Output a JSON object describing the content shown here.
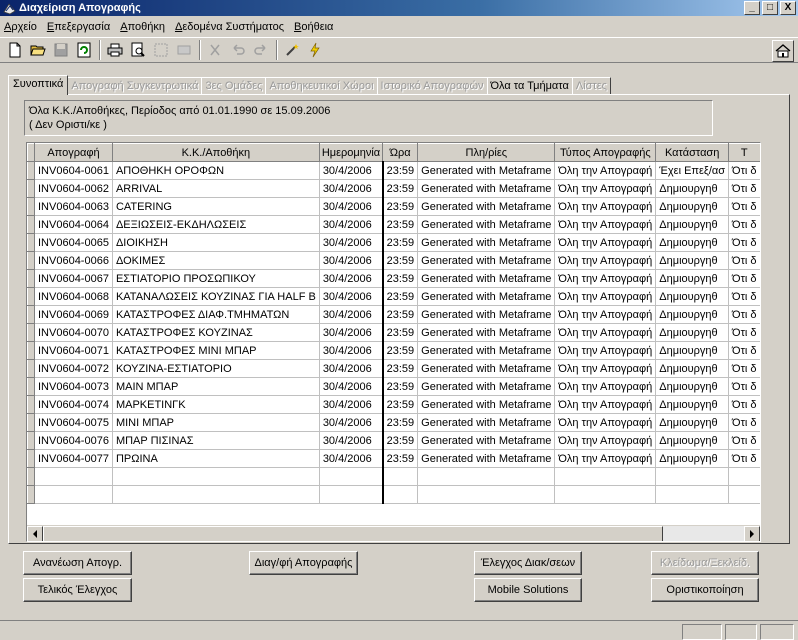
{
  "window": {
    "title": "Διαχείριση Απογραφής",
    "min": "_",
    "max": "□",
    "close": "X"
  },
  "menu": [
    "Αρχείο",
    "Επεξεργασία",
    "Αποθήκη",
    "Δεδομένα Συστήματος",
    "Βοήθεια"
  ],
  "toolbar": {
    "icons": [
      "new-icon",
      "open-icon",
      "save-icon",
      "refresh-icon",
      "print-icon",
      "print-preview-icon",
      "select-icon",
      "calc-icon",
      "cut-icon",
      "undo-icon",
      "redo-icon",
      "wand-icon",
      "lightning-icon"
    ],
    "home_icon": "home-icon"
  },
  "tabs": [
    {
      "label": "Συνοπτικά",
      "state": "active"
    },
    {
      "label": "Απογραφή Συγκεντρωτικά",
      "state": "disabled"
    },
    {
      "label": "3ες Ομάδες",
      "state": "disabled"
    },
    {
      "label": "Αποθηκευτικοί Χώροι",
      "state": "disabled"
    },
    {
      "label": "Ιστορικό Απογραφών",
      "state": "disabled"
    },
    {
      "label": "Όλα τα Τμήματα",
      "state": "normal"
    },
    {
      "label": "Λίστες",
      "state": "disabled"
    }
  ],
  "summary": {
    "line1": "Όλα Κ.Κ./Αποθήκες, Περίοδος από 01.01.1990  σε  15.09.2006",
    "line2": "( Δεν Οριστι/κε )"
  },
  "grid": {
    "columns": [
      "Απογραφή",
      "Κ.Κ./Αποθήκη",
      "Ημερομηνία",
      "Ώρα",
      "Πλη/ρίες",
      "Τύπος Απογραφής",
      "Κατάσταση",
      "Τ"
    ],
    "rows": [
      [
        "INV0604-0061",
        "ΑΠΟΘΗΚΗ ΟΡΟΦΩΝ",
        "30/4/2006",
        "23:59",
        "Generated with Metaframe",
        "Όλη την Απογραφή",
        "Έχει Επεξ/ασ",
        "Ότι δ"
      ],
      [
        "INV0604-0062",
        "ARRIVAL",
        "30/4/2006",
        "23:59",
        "Generated with Metaframe",
        "Όλη την Απογραφή",
        "Δημιουργηθ",
        "Ότι δ"
      ],
      [
        "INV0604-0063",
        "CATERING",
        "30/4/2006",
        "23:59",
        "Generated with Metaframe",
        "Όλη την Απογραφή",
        "Δημιουργηθ",
        "Ότι δ"
      ],
      [
        "INV0604-0064",
        "ΔΕΞΙΩΣΕΙΣ-ΕΚΔΗΛΩΣΕΙΣ",
        "30/4/2006",
        "23:59",
        "Generated with Metaframe",
        "Όλη την Απογραφή",
        "Δημιουργηθ",
        "Ότι δ"
      ],
      [
        "INV0604-0065",
        "ΔΙΟΙΚΗΣΗ",
        "30/4/2006",
        "23:59",
        "Generated with Metaframe",
        "Όλη την Απογραφή",
        "Δημιουργηθ",
        "Ότι δ"
      ],
      [
        "INV0604-0066",
        "ΔΟΚΙΜΕΣ",
        "30/4/2006",
        "23:59",
        "Generated with Metaframe",
        "Όλη την Απογραφή",
        "Δημιουργηθ",
        "Ότι δ"
      ],
      [
        "INV0604-0067",
        "ΕΣΤΙΑΤΟΡΙΟ ΠΡΟΣΩΠΙΚΟΥ",
        "30/4/2006",
        "23:59",
        "Generated with Metaframe",
        "Όλη την Απογραφή",
        "Δημιουργηθ",
        "Ότι δ"
      ],
      [
        "INV0604-0068",
        "ΚΑΤΑΝΑΛΩΣΕΙΣ ΚΟΥΖΙΝΑΣ ΓΙΑ HALF B",
        "30/4/2006",
        "23:59",
        "Generated with Metaframe",
        "Όλη την Απογραφή",
        "Δημιουργηθ",
        "Ότι δ"
      ],
      [
        "INV0604-0069",
        "ΚΑΤΑΣΤΡΟΦΕΣ ΔΙΑΦ.ΤΜΗΜΑΤΩΝ",
        "30/4/2006",
        "23:59",
        "Generated with Metaframe",
        "Όλη την Απογραφή",
        "Δημιουργηθ",
        "Ότι δ"
      ],
      [
        "INV0604-0070",
        "ΚΑΤΑΣΤΡΟΦΕΣ ΚΟΥΖΙΝΑΣ",
        "30/4/2006",
        "23:59",
        "Generated with Metaframe",
        "Όλη την Απογραφή",
        "Δημιουργηθ",
        "Ότι δ"
      ],
      [
        "INV0604-0071",
        "ΚΑΤΑΣΤΡΟΦΕΣ ΜΙΝΙ ΜΠΑΡ",
        "30/4/2006",
        "23:59",
        "Generated with Metaframe",
        "Όλη την Απογραφή",
        "Δημιουργηθ",
        "Ότι δ"
      ],
      [
        "INV0604-0072",
        "ΚΟΥΖΙΝΑ-ΕΣΤΙΑΤΟΡΙΟ",
        "30/4/2006",
        "23:59",
        "Generated with Metaframe",
        "Όλη την Απογραφή",
        "Δημιουργηθ",
        "Ότι δ"
      ],
      [
        "INV0604-0073",
        "ΜΑΙΝ ΜΠΑΡ",
        "30/4/2006",
        "23:59",
        "Generated with Metaframe",
        "Όλη την Απογραφή",
        "Δημιουργηθ",
        "Ότι δ"
      ],
      [
        "INV0604-0074",
        "ΜΑΡΚΕΤΙΝΓΚ",
        "30/4/2006",
        "23:59",
        "Generated with Metaframe",
        "Όλη την Απογραφή",
        "Δημιουργηθ",
        "Ότι δ"
      ],
      [
        "INV0604-0075",
        "ΜΙΝΙ ΜΠΑΡ",
        "30/4/2006",
        "23:59",
        "Generated with Metaframe",
        "Όλη την Απογραφή",
        "Δημιουργηθ",
        "Ότι δ"
      ],
      [
        "INV0604-0076",
        "ΜΠΑΡ ΠΙΣΙΝΑΣ",
        "30/4/2006",
        "23:59",
        "Generated with Metaframe",
        "Όλη την Απογραφή",
        "Δημιουργηθ",
        "Ότι δ"
      ],
      [
        "INV0604-0077",
        "ΠΡΩΙΝΑ",
        "30/4/2006",
        "23:59",
        "Generated with Metaframe",
        "Όλη την Απογραφή",
        "Δημιουργηθ",
        "Ότι δ"
      ]
    ]
  },
  "buttons": {
    "refresh": "Ανανέωση Απογρ.",
    "final_check": "Τελικός Έλεγχος",
    "delete": "Διαγ/φή Απογραφής",
    "check_diff": "Έλεγχος Διακ/σεων",
    "mobile": "Mobile Solutions",
    "lock": "Κλείδωμα/Ξεκλείδ.",
    "finalize": "Οριστικοποίηση"
  }
}
